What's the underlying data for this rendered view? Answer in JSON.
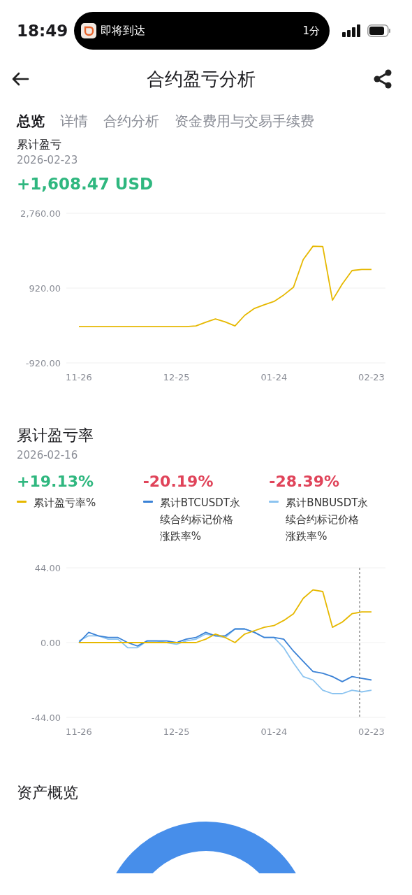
{
  "status_bar": {
    "time": "18:49",
    "activity": {
      "label": "即将到达",
      "eta": "1分"
    }
  },
  "header": {
    "title": "合约盈亏分析"
  },
  "tabs": [
    {
      "label": "总览",
      "selected": true
    },
    {
      "label": "详情",
      "selected": false
    },
    {
      "label": "合约分析",
      "selected": false
    },
    {
      "label": "资金费用与交易手续费",
      "selected": false
    }
  ],
  "pnl": {
    "title": "累计盈亏",
    "date": "2026-02-23",
    "value": "+1,608.47 USD",
    "chart_data": {
      "type": "line",
      "categories": [
        "11-26",
        null,
        null,
        null,
        null,
        null,
        null,
        null,
        null,
        null,
        "12-25",
        null,
        null,
        null,
        null,
        null,
        null,
        null,
        null,
        null,
        "01-24",
        null,
        null,
        null,
        null,
        null,
        null,
        null,
        null,
        null,
        "02-23"
      ],
      "ylim": [
        -920,
        2760
      ],
      "yticks": [
        {
          "value": 2760,
          "label": "2,760.00"
        },
        {
          "value": 920,
          "label": "920.00"
        },
        {
          "value": -920,
          "label": "-920.00"
        }
      ],
      "series": [
        {
          "color": "#e6b800",
          "values": [
            -30,
            -30,
            -30,
            -30,
            -30,
            -30,
            -30,
            -30,
            -30,
            -30,
            -30,
            -30,
            -10,
            80,
            160,
            90,
            -10,
            250,
            420,
            510,
            590,
            750,
            940,
            1620,
            1950,
            1940,
            620,
            1020,
            1350,
            1380,
            1380
          ]
        }
      ]
    }
  },
  "rate": {
    "title": "累计盈亏率",
    "date": "2026-02-16",
    "stats": [
      {
        "value": "+19.13%",
        "positive": true
      },
      {
        "value": "-20.19%",
        "positive": false
      },
      {
        "value": "-28.39%",
        "positive": false
      }
    ],
    "chart_data": {
      "type": "line",
      "categories": [
        "11-26",
        null,
        null,
        null,
        null,
        null,
        null,
        null,
        null,
        null,
        "12-25",
        null,
        null,
        null,
        null,
        null,
        null,
        null,
        null,
        null,
        "01-24",
        null,
        null,
        null,
        null,
        null,
        null,
        null,
        null,
        null,
        "02-23"
      ],
      "ylim": [
        -44,
        44
      ],
      "yticks": [
        {
          "value": 44,
          "label": "44.00"
        },
        {
          "value": 0,
          "label": "0.00"
        },
        {
          "value": -44,
          "label": "-44.00"
        }
      ],
      "series": [
        {
          "name": "累计盈亏率%",
          "color": "#e6b800",
          "values": [
            0,
            0,
            0,
            0,
            0,
            0,
            0,
            0,
            0,
            0,
            0,
            0,
            0,
            2,
            5,
            3,
            0,
            5,
            7,
            9,
            10,
            13,
            17,
            26,
            31,
            30,
            9,
            12,
            17,
            18,
            18
          ]
        },
        {
          "name": "累计BTCUSDT永续合约标记价格涨跌率%",
          "color": "#3b82d6",
          "values": [
            0,
            6,
            4,
            3,
            3,
            0,
            -2,
            1,
            1,
            1,
            0,
            2,
            3,
            6,
            4,
            4,
            8,
            8,
            6,
            3,
            3,
            2,
            -5,
            -11,
            -17,
            -18,
            -20,
            -23,
            -20,
            -21,
            -22
          ]
        },
        {
          "name": "累计BNBUSDT永续合约标记价格涨跌率%",
          "color": "#8cc4f0",
          "values": [
            1,
            4,
            4,
            2,
            2,
            -3,
            -3,
            1,
            1,
            0,
            -1,
            1,
            2,
            5,
            4,
            3,
            8,
            8,
            6,
            3,
            3,
            -3,
            -12,
            -20,
            -22,
            -28,
            -30,
            -30,
            -28,
            -29,
            -28
          ]
        }
      ]
    }
  },
  "assets": {
    "title": "资产概览"
  }
}
